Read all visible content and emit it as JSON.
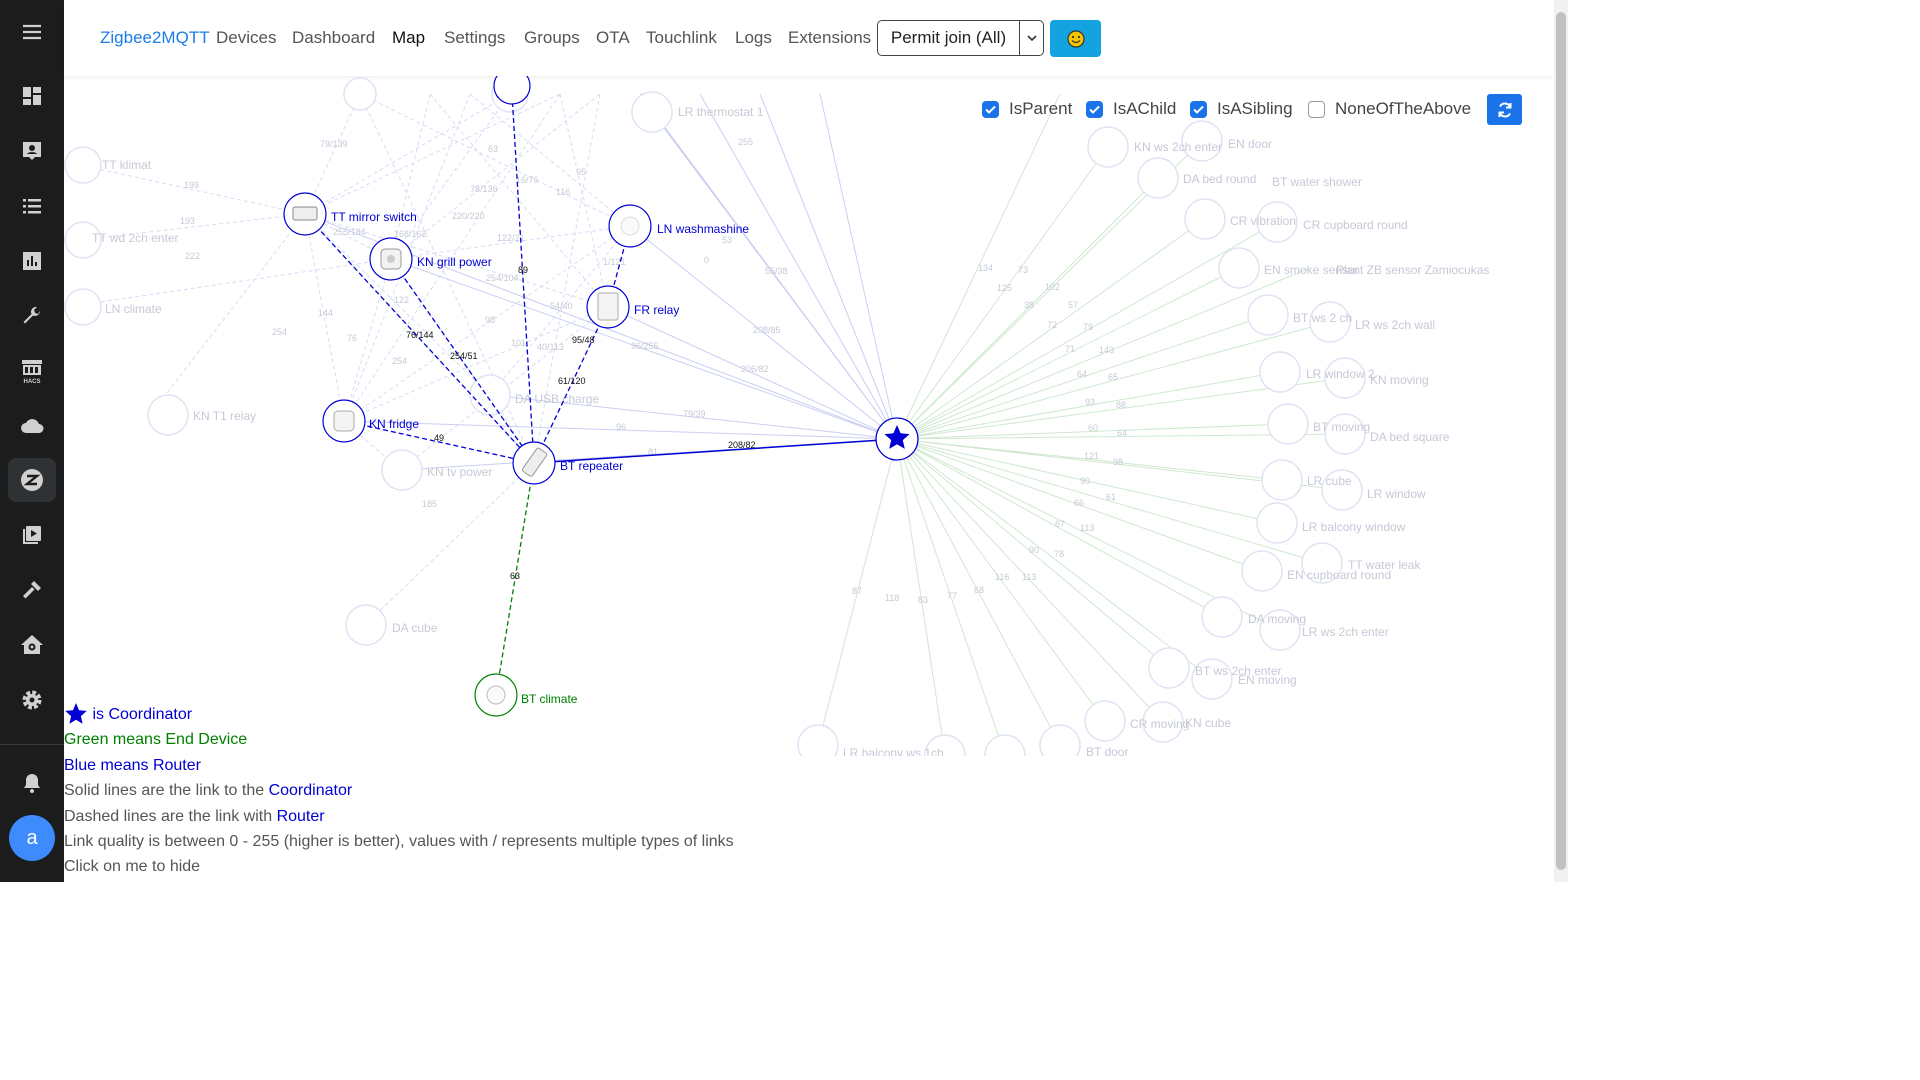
{
  "nav": {
    "brand": "Zigbee2MQTT",
    "items": [
      "Devices",
      "Dashboard",
      "Map",
      "Settings",
      "Groups",
      "OTA",
      "Touchlink",
      "Logs",
      "Extensions"
    ],
    "permit_join": "Permit join (All)"
  },
  "filters": [
    {
      "label": "IsParent",
      "checked": true
    },
    {
      "label": "IsAChild",
      "checked": true
    },
    {
      "label": "IsASibling",
      "checked": true
    },
    {
      "label": "NoneOfTheAbove",
      "checked": false
    }
  ],
  "legend": {
    "coordinator": "is Coordinator",
    "green_line": "Green means End Device",
    "blue_line": "Blue means Router",
    "solid_pre": "Solid lines are the link to the ",
    "solid_link": "Coordinator",
    "dashed_pre": "Dashed lines are the link with ",
    "dashed_link": "Router",
    "quality": "Link quality is between 0 - 255 (higher is better), values with / represents multiple types of links",
    "hide": "Click on me to hide"
  },
  "colors": {
    "router": "#0000d6",
    "end_device": "#008000",
    "brand": "#1a7ee6",
    "button": "#12a3e0",
    "accent": "#1a73e8"
  },
  "map": {
    "nodes": {
      "tt_mirror_switch": "TT mirror switch",
      "kn_grill_power": "KN grill power",
      "ln_washmashine": "LN washmashine",
      "fr_relay": "FR relay",
      "kn_fridge": "KN fridge",
      "bt_repeater": "BT repeater",
      "bt_climate": "BT climate"
    },
    "faded_nodes": [
      "LR thermostat 1",
      "TT klimat",
      "TT wd 2ch enter",
      "LN climate",
      "KN T1 relay",
      "KN tv power",
      "DA USB charge",
      "DA cube",
      "KN ws 2ch enter",
      "EN door",
      "DA bed round",
      "BT water shower",
      "CR vibration",
      "CR cupboard round",
      "EN smoke sensor",
      "Plant ZB sensor Zamiocukas",
      "BT ws 2 ch",
      "LR ws 2ch wall",
      "LR window 2",
      "KN moving",
      "BT moving",
      "DA bed square",
      "LR cube",
      "LR window",
      "LR balcony window",
      "TT water leak",
      "EN cupboard round",
      "DA moving",
      "LR ws 2ch enter",
      "BT ws 2ch enter",
      "EN moving",
      "CR moving",
      "KN cube",
      "LR balcony ws 1ch",
      "BT door"
    ],
    "links": {
      "repeater_coordinator": "208/82",
      "mirror_repeater": "76/144",
      "grill_repeater": "254/51",
      "wash_relay": "95/48",
      "relay_repeater": "61/120",
      "top_repeater": "89",
      "fridge_repeater": "49",
      "repeater_climate": "63"
    }
  }
}
